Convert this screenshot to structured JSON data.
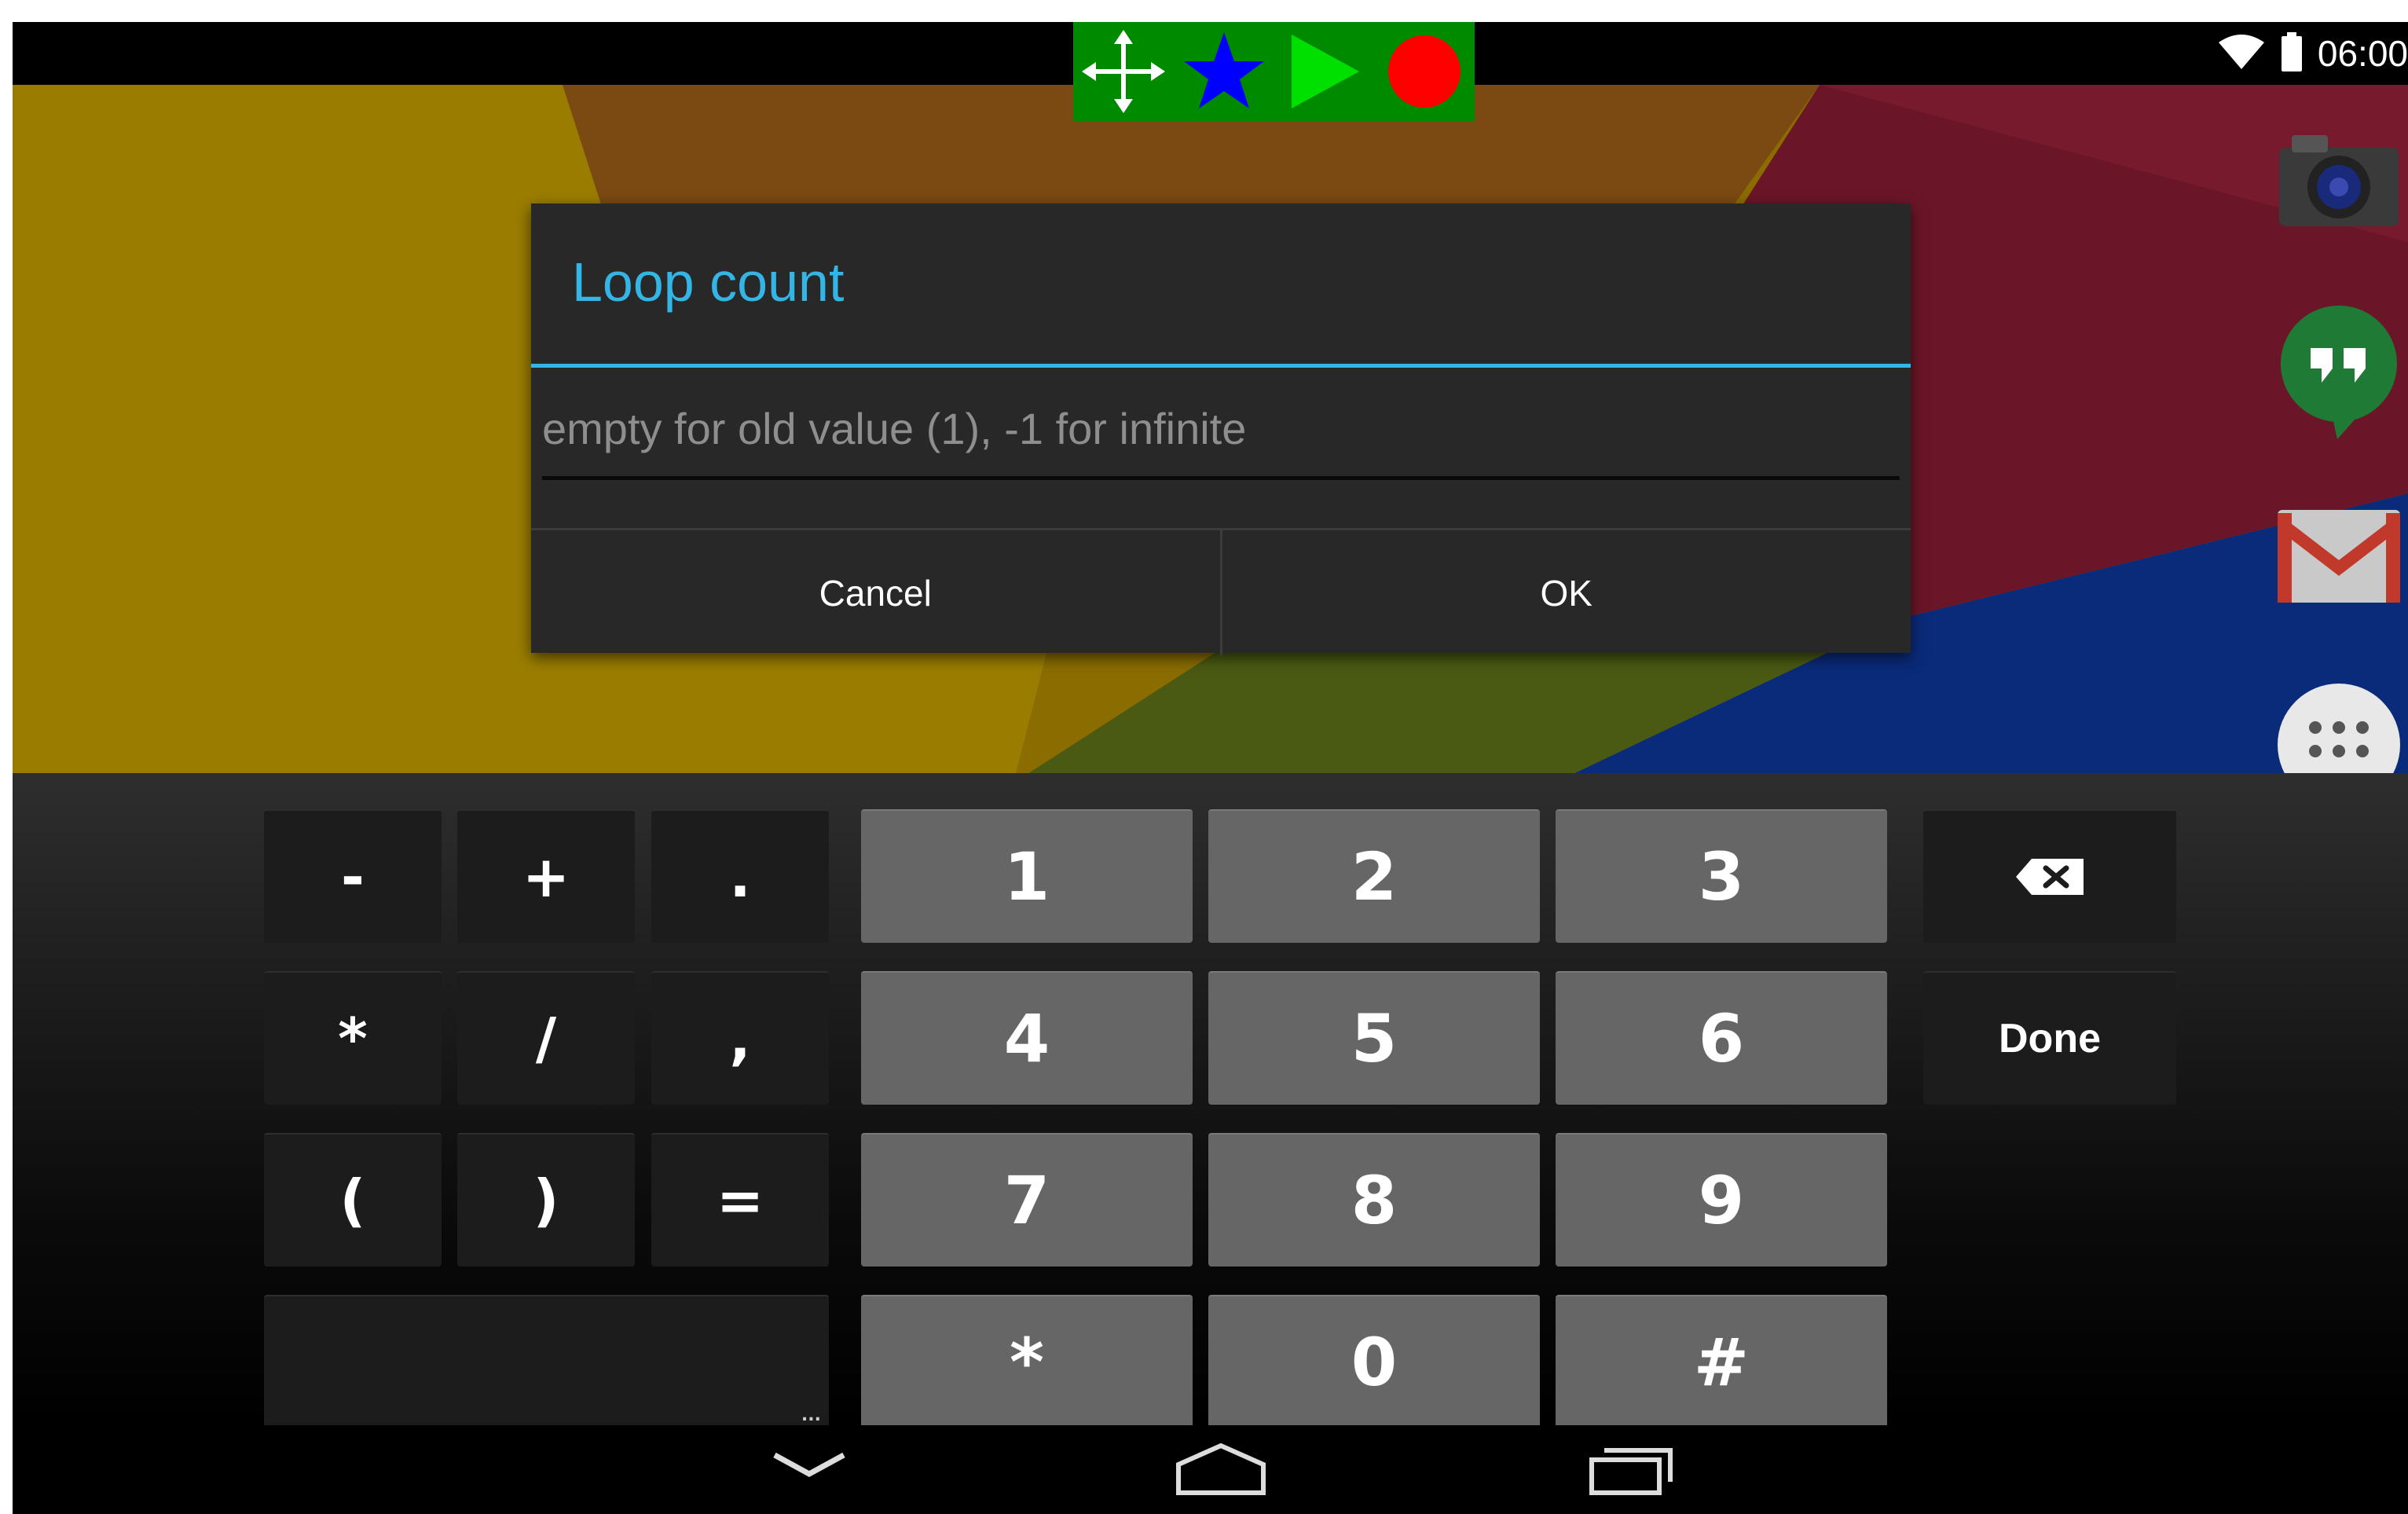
{
  "status_bar": {
    "time": "06:00",
    "icons": [
      "wifi-icon",
      "battery-icon"
    ]
  },
  "macro_toolbar": {
    "buttons": [
      "move-icon",
      "star-icon",
      "play-icon",
      "record-icon"
    ]
  },
  "dock": {
    "icons": [
      "camera-icon",
      "hangouts-icon",
      "gmail-icon",
      "app-drawer-icon"
    ]
  },
  "dialog": {
    "title": "Loop count",
    "input_placeholder": "empty for old value (1), -1 for infinite",
    "cancel_label": "Cancel",
    "ok_label": "OK"
  },
  "keyboard": {
    "symbols": [
      "-",
      "+",
      ".",
      "*",
      "/",
      ",",
      "(",
      ")",
      "="
    ],
    "digits": [
      "1",
      "2",
      "3",
      "4",
      "5",
      "6",
      "7",
      "8",
      "9",
      "*",
      "0",
      "#"
    ],
    "space_hint": "...",
    "done_label": "Done",
    "backspace_icon": "backspace-icon"
  },
  "nav_bar": {
    "icons": [
      "back-icon",
      "home-icon",
      "recents-icon"
    ]
  },
  "colors": {
    "accent": "#33b5e5",
    "toolbar_green": "#008a00",
    "record_red": "#ff0000",
    "star_blue": "#0000ff",
    "play_green": "#00e000",
    "dialog_bg": "#282828",
    "key_num": "#666666",
    "key_dark": "#1c1c1c"
  }
}
